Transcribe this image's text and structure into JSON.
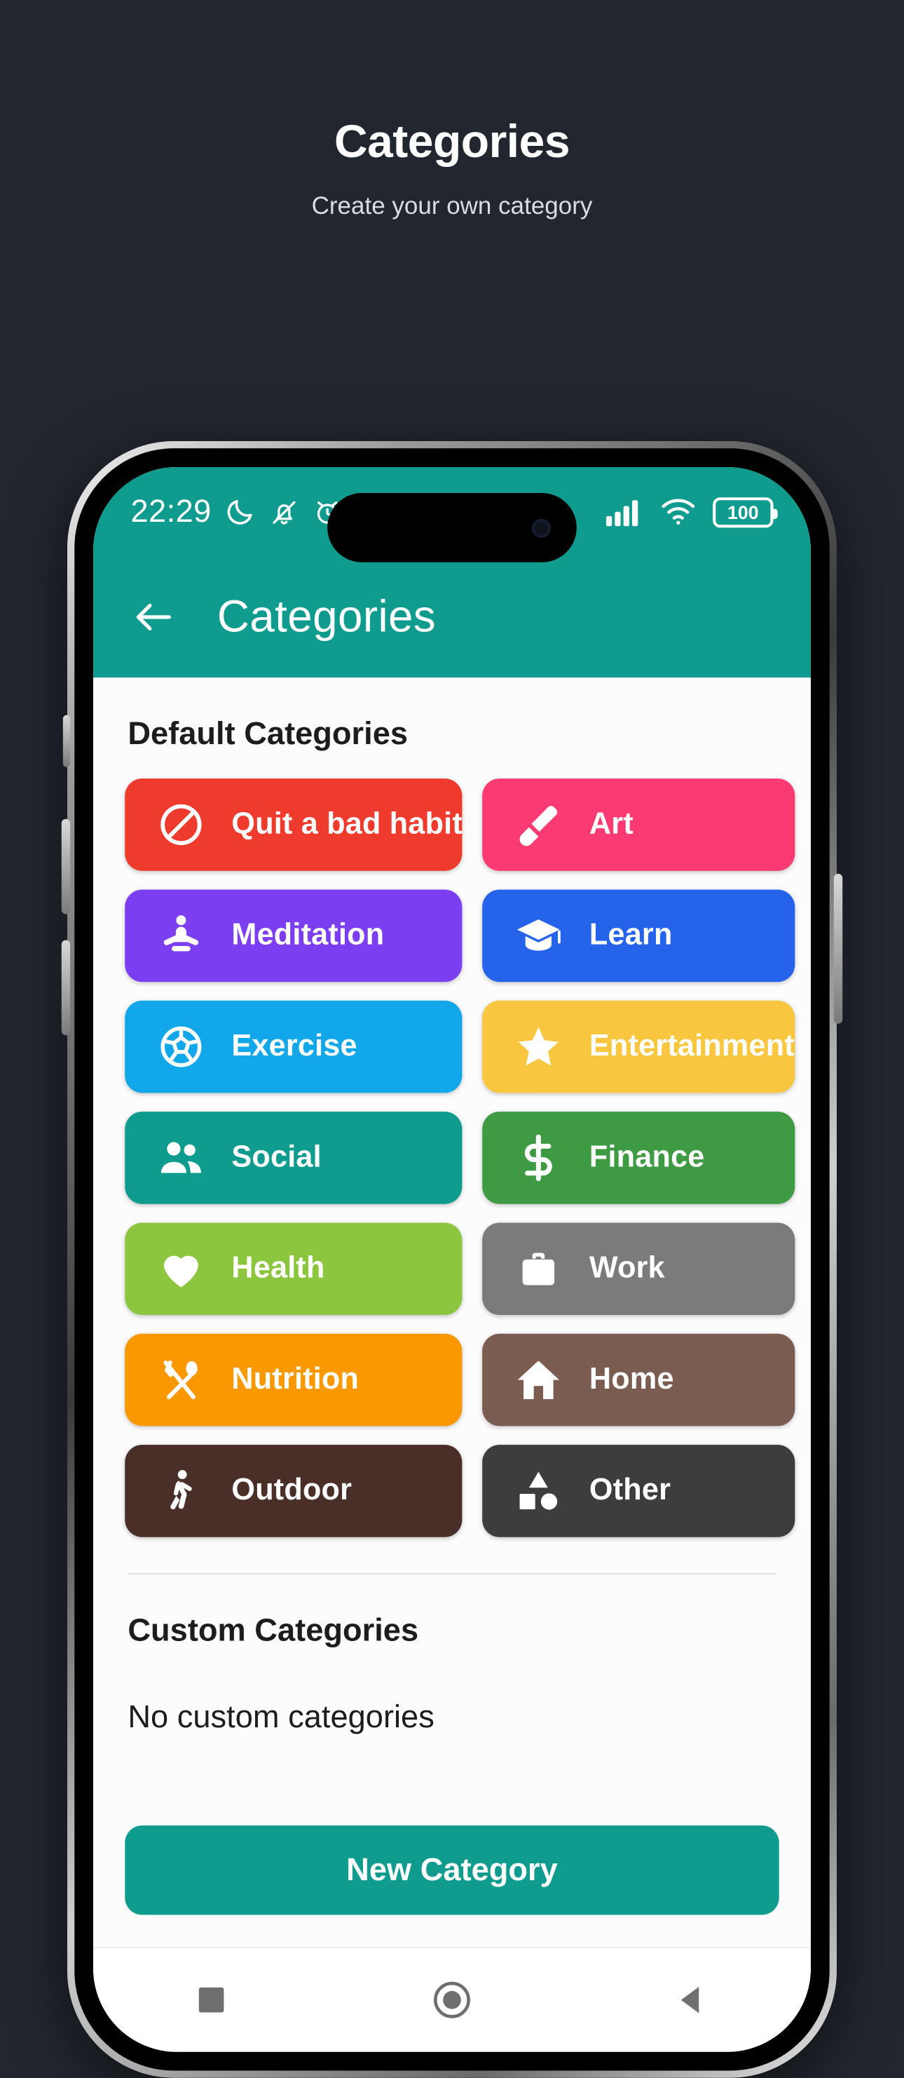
{
  "promo": {
    "title": "Categories",
    "subtitle": "Create your own category"
  },
  "colors": {
    "page_background": "#22262e",
    "brand_teal": "#0f9b8e",
    "app_background": "#fdfcfd"
  },
  "phone": {
    "status_bar": {
      "clock": "22:29",
      "left_icons": [
        "moon-icon",
        "bell-muted-icon",
        "alarm-icon",
        "whatsapp-icon",
        "upload-icon"
      ],
      "right_icons": [
        "cellular-signal-icon",
        "wifi-icon"
      ],
      "battery_level": "100"
    },
    "app_bar": {
      "back_icon": "back-arrow-icon",
      "title": "Categories"
    },
    "sections": {
      "default_title": "Default Categories",
      "custom_title": "Custom Categories",
      "custom_empty": "No custom categories"
    },
    "default_categories": [
      {
        "label": "Quit a bad habit",
        "color": "#ef3b2d",
        "icon": "block-icon"
      },
      {
        "label": "Art",
        "color": "#fa3a71",
        "icon": "paintbrush-icon"
      },
      {
        "label": "Meditation",
        "color": "#7b3ef0",
        "icon": "meditation-icon"
      },
      {
        "label": "Learn",
        "color": "#2563eb",
        "icon": "graduation-cap-icon"
      },
      {
        "label": "Exercise",
        "color": "#12a7e8",
        "icon": "soccer-ball-icon"
      },
      {
        "label": "Entertainment",
        "color": "#f8c73f",
        "icon": "star-icon"
      },
      {
        "label": "Social",
        "color": "#0f9b8e",
        "icon": "people-icon"
      },
      {
        "label": "Finance",
        "color": "#3f9b43",
        "icon": "dollar-icon"
      },
      {
        "label": "Health",
        "color": "#8cc63f",
        "icon": "heart-icon"
      },
      {
        "label": "Work",
        "color": "#7b7b7b",
        "icon": "briefcase-icon"
      },
      {
        "label": "Nutrition",
        "color": "#fa9800",
        "icon": "fork-spoon-icon"
      },
      {
        "label": "Home",
        "color": "#7a5c50",
        "icon": "house-icon"
      },
      {
        "label": "Outdoor",
        "color": "#4a2f28",
        "icon": "walking-person-icon"
      },
      {
        "label": "Other",
        "color": "#3d3d3d",
        "icon": "shapes-icon"
      }
    ],
    "new_category_button": "New Category",
    "nav_bar": [
      "square-recents-icon",
      "circle-home-icon",
      "triangle-back-icon"
    ]
  }
}
